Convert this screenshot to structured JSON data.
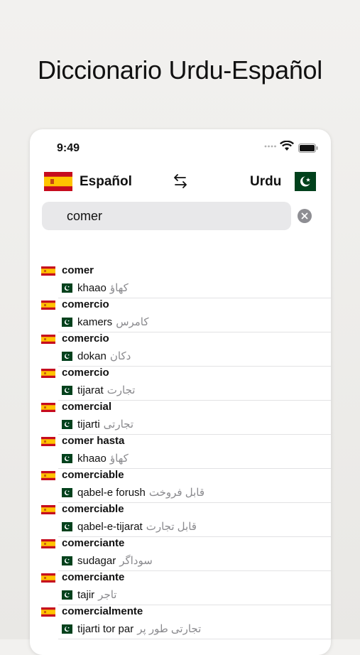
{
  "headline": "Diccionario Urdu-Español",
  "status": {
    "time": "9:49"
  },
  "languages": {
    "source": "Español",
    "target": "Urdu"
  },
  "search": {
    "value": "comer",
    "placeholder": ""
  },
  "results": [
    {
      "term": "comer",
      "translit": "khaao",
      "urdu": "کھاؤ"
    },
    {
      "term": "comercio",
      "translit": "kamers",
      "urdu": "کامرس"
    },
    {
      "term": "comercio",
      "translit": "dokan",
      "urdu": "دکان"
    },
    {
      "term": "comercio",
      "translit": "tijarat",
      "urdu": "تجارت"
    },
    {
      "term": "comercial",
      "translit": "tijarti",
      "urdu": "تجارتی"
    },
    {
      "term": "comer hasta",
      "translit": "khaao",
      "urdu": "کھاؤ"
    },
    {
      "term": "comerciable",
      "translit": "qabel-e forush",
      "urdu": "قابل فروخت"
    },
    {
      "term": "comerciable",
      "translit": "qabel-e-tijarat",
      "urdu": "قابل تجارت"
    },
    {
      "term": "comerciante",
      "translit": "sudagar",
      "urdu": "سوداگر"
    },
    {
      "term": "comerciante",
      "translit": "tajir",
      "urdu": "تاجر"
    },
    {
      "term": "comercialmente",
      "translit": "tijarti tor par",
      "urdu": "تجارتی طور پر"
    }
  ],
  "colors": {
    "spain_red": "#c60b1e",
    "spain_yellow": "#ffc400",
    "pakistan_green": "#01411c"
  }
}
